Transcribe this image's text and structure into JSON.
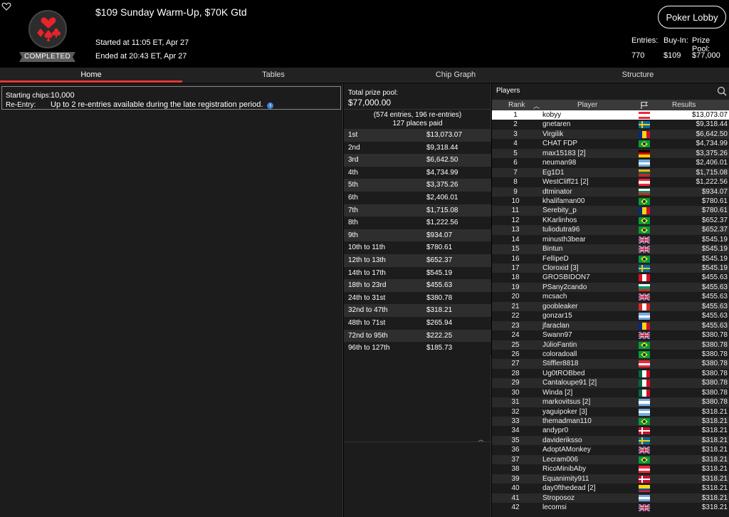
{
  "header": {
    "title": "$109 Sunday Warm-Up, $70K Gtd",
    "started": "Started at 11:05 ET, Apr 27",
    "ended": "Ended at 20:43 ET, Apr 27",
    "status_badge": "COMPLETED",
    "lobby_button": "Poker Lobby",
    "stats": {
      "entries_label": "Entries:",
      "entries_value": "770",
      "buyin_label": "Buy-In:",
      "buyin_value": "$109",
      "prize_label": "Prize Pool:",
      "prize_value": "$77,000"
    },
    "colors": {
      "accent": "#e53935",
      "logo_suit": "#e8232a"
    }
  },
  "tabs": [
    {
      "label": "Home",
      "active": true
    },
    {
      "label": "Tables",
      "active": false
    },
    {
      "label": "Chip Graph",
      "active": false
    },
    {
      "label": "Structure",
      "active": false
    }
  ],
  "info": {
    "chips_label": "Starting chips:",
    "chips_value": "10,000",
    "reentry_label": "Re-Entry:",
    "reentry_value": "Up to 2 re-entries available during the late registration period."
  },
  "prize": {
    "total_label": "Total prize pool:",
    "total_value": "$77,000.00",
    "entries_note": "(574 entries, 196 re-entries)",
    "places_note": "127 places paid",
    "payouts": [
      {
        "place": "1st",
        "amount": "$13,073.07"
      },
      {
        "place": "2nd",
        "amount": "$9,318.44"
      },
      {
        "place": "3rd",
        "amount": "$6,642.50"
      },
      {
        "place": "4th",
        "amount": "$4,734.99"
      },
      {
        "place": "5th",
        "amount": "$3,375.26"
      },
      {
        "place": "6th",
        "amount": "$2,406.01"
      },
      {
        "place": "7th",
        "amount": "$1,715.08"
      },
      {
        "place": "8th",
        "amount": "$1,222.56"
      },
      {
        "place": "9th",
        "amount": "$934.07"
      },
      {
        "place": "10th to 11th",
        "amount": "$780.61"
      },
      {
        "place": "12th to 13th",
        "amount": "$652.37"
      },
      {
        "place": "14th to 17th",
        "amount": "$545.19"
      },
      {
        "place": "18th to 23rd",
        "amount": "$455.63"
      },
      {
        "place": "24th to 31st",
        "amount": "$380.78"
      },
      {
        "place": "32nd to 47th",
        "amount": "$318.21"
      },
      {
        "place": "48th to 71st",
        "amount": "$265.94"
      },
      {
        "place": "72nd to 95th",
        "amount": "$222.25"
      },
      {
        "place": "96th to 127th",
        "amount": "$185.73"
      }
    ]
  },
  "players": {
    "title": "Players",
    "col_rank": "Rank",
    "col_player": "Player",
    "col_results": "Results",
    "rows": [
      {
        "rank": "1",
        "name": "kobyy",
        "flag": "at",
        "result": "$13,073.07"
      },
      {
        "rank": "2",
        "name": "gnetaren",
        "flag": "se",
        "result": "$9,318.44"
      },
      {
        "rank": "3",
        "name": "Virgilik",
        "flag": "ro",
        "result": "$6,642.50"
      },
      {
        "rank": "4",
        "name": "CHAT FDP",
        "flag": "br",
        "result": "$4,734.99"
      },
      {
        "rank": "5",
        "name": "max15183 [2]",
        "flag": "de",
        "result": "$3,375.26"
      },
      {
        "rank": "6",
        "name": "neuman98",
        "flag": "ar",
        "result": "$2,406.01"
      },
      {
        "rank": "7",
        "name": "Eg1D1",
        "flag": "lt",
        "result": "$1,715.08"
      },
      {
        "rank": "8",
        "name": "WestCliff21 [2]",
        "flag": "at",
        "result": "$1,222.56"
      },
      {
        "rank": "9",
        "name": "dtminator",
        "flag": "bg",
        "result": "$934.07"
      },
      {
        "rank": "10",
        "name": "khalifaman00",
        "flag": "br",
        "result": "$780.61"
      },
      {
        "rank": "11",
        "name": "Serebity_p",
        "flag": "ro",
        "result": "$780.61"
      },
      {
        "rank": "12",
        "name": "KKarlinhos",
        "flag": "br",
        "result": "$652.37"
      },
      {
        "rank": "13",
        "name": "tuliodutra96",
        "flag": "br",
        "result": "$652.37"
      },
      {
        "rank": "14",
        "name": "minusth3bear",
        "flag": "gb",
        "result": "$545.19"
      },
      {
        "rank": "15",
        "name": "Bintun",
        "flag": "gb",
        "result": "$545.19"
      },
      {
        "rank": "16",
        "name": "FellipeD",
        "flag": "br",
        "result": "$545.19"
      },
      {
        "rank": "17",
        "name": "Cloroxid [3]",
        "flag": "se",
        "result": "$545.19"
      },
      {
        "rank": "18",
        "name": "GROSBIDON7",
        "flag": "pe",
        "result": "$455.63"
      },
      {
        "rank": "19",
        "name": "PSany2cando",
        "flag": "bg",
        "result": "$455.63"
      },
      {
        "rank": "20",
        "name": "mcsach",
        "flag": "gb",
        "result": "$455.63"
      },
      {
        "rank": "21",
        "name": "goobleaker",
        "flag": "ca",
        "result": "$455.63"
      },
      {
        "rank": "22",
        "name": "gonzar15",
        "flag": "ar",
        "result": "$455.63"
      },
      {
        "rank": "23",
        "name": "jfaraclan",
        "flag": "ro",
        "result": "$455.63"
      },
      {
        "rank": "24",
        "name": "Swann97",
        "flag": "gb",
        "result": "$380.78"
      },
      {
        "rank": "25",
        "name": "JúlioFantin",
        "flag": "br",
        "result": "$380.78"
      },
      {
        "rank": "26",
        "name": "coloradoall",
        "flag": "br",
        "result": "$380.78"
      },
      {
        "rank": "27",
        "name": "Stiffler8818",
        "flag": "at",
        "result": "$380.78"
      },
      {
        "rank": "28",
        "name": "Ug0tROBbed",
        "flag": "mx",
        "result": "$380.78"
      },
      {
        "rank": "29",
        "name": "Cantaloupe91 [2]",
        "flag": "mx",
        "result": "$380.78"
      },
      {
        "rank": "30",
        "name": "Winda [2]",
        "flag": "mx",
        "result": "$380.78"
      },
      {
        "rank": "31",
        "name": "markovitsus [2]",
        "flag": "ar",
        "result": "$380.78"
      },
      {
        "rank": "32",
        "name": "yaguipoker [3]",
        "flag": "ar",
        "result": "$318.21"
      },
      {
        "rank": "33",
        "name": "themadman110",
        "flag": "br",
        "result": "$318.21"
      },
      {
        "rank": "34",
        "name": "andypr0",
        "flag": "dk",
        "result": "$318.21"
      },
      {
        "rank": "35",
        "name": "davideriksso",
        "flag": "se",
        "result": "$318.21"
      },
      {
        "rank": "36",
        "name": "AdoptAMonkey",
        "flag": "gb",
        "result": "$318.21"
      },
      {
        "rank": "37",
        "name": "Lecram006",
        "flag": "br",
        "result": "$318.21"
      },
      {
        "rank": "38",
        "name": "RicoMinibAby",
        "flag": "at",
        "result": "$318.21"
      },
      {
        "rank": "39",
        "name": "Equanimity911",
        "flag": "dk",
        "result": "$318.21"
      },
      {
        "rank": "40",
        "name": "day0fthedead [2]",
        "flag": "ec",
        "result": "$318.21"
      },
      {
        "rank": "41",
        "name": "Stroposoz",
        "flag": "ar",
        "result": "$318.21"
      },
      {
        "rank": "42",
        "name": "lecomsi",
        "flag": "gb",
        "result": "$318.21"
      }
    ]
  }
}
